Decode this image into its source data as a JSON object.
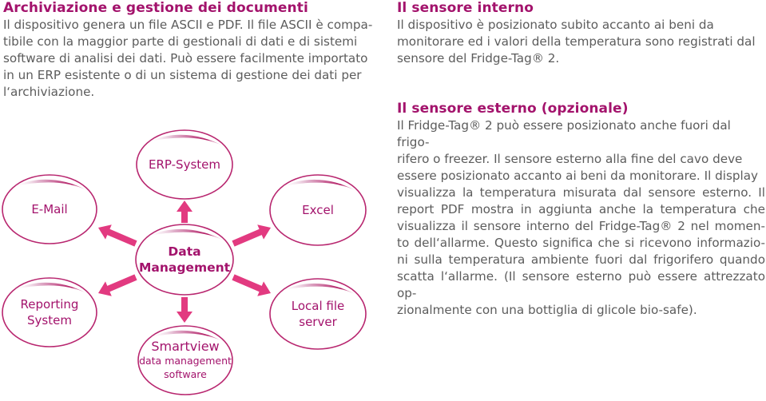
{
  "colors": {
    "heading": "#a3136c",
    "body_text": "#5c5c5c",
    "arrow": "#e23a80",
    "node_stroke": "#b8266f",
    "node_text": "#a3136c"
  },
  "archiving": {
    "title": "Archiviazione e gestione dei documenti",
    "lines": [
      "Il dispositivo genera un file ASCII e PDF. Il file ASCII è compa-",
      "tibile con la maggior parte di gestionali di dati e di sistemi",
      "software di analisi dei dati. Può essere facilmente importato",
      "in un ERP esistente o di un sistema di gestione dei dati per",
      "l‘archiviazione."
    ]
  },
  "internal_sensor": {
    "title": "Il sensore interno",
    "lines": [
      "Il dispositivo è posizionato subito accanto ai beni da",
      "monitorare ed i valori della temperatura sono registrati dal",
      "sensore del Fridge-Tag® 2."
    ]
  },
  "external_sensor": {
    "title": "Il sensore esterno (opzionale)",
    "lines": [
      "Il Fridge-Tag® 2 può essere posizionato anche fuori dal frigo-",
      "rifero o freezer. Il sensore esterno alla fine del cavo deve",
      "essere posizionato accanto ai beni da monitorare. Il display",
      "visualizza la temperatura misurata dal sensore esterno. Il",
      "report PDF mostra in aggiunta anche la temperatura che",
      "visualizza il sensore interno del Fridge-Tag® 2 nel momen-",
      "to dell‘allarme. Questo significa che si ricevono informazio-",
      "ni sulla temperatura ambiente fuori dal frigorifero quando",
      "scatta l‘allarme. (Il sensore esterno può essere attrezzato op-",
      "zionalmente con una bottiglia di glicole bio-safe)."
    ]
  },
  "diagram": {
    "center": {
      "id": "data-management",
      "lines": [
        "Data",
        "Management"
      ]
    },
    "nodes": [
      {
        "id": "erp-system",
        "lines": [
          "ERP-System"
        ]
      },
      {
        "id": "e-mail",
        "lines": [
          "E-Mail"
        ]
      },
      {
        "id": "excel",
        "lines": [
          "Excel"
        ]
      },
      {
        "id": "reporting-system",
        "lines": [
          "Reporting",
          "System"
        ]
      },
      {
        "id": "local-file-server",
        "lines": [
          "Local file",
          "server"
        ]
      },
      {
        "id": "smartview",
        "lines": [
          "Smartview",
          "data management",
          "software"
        ]
      }
    ]
  }
}
